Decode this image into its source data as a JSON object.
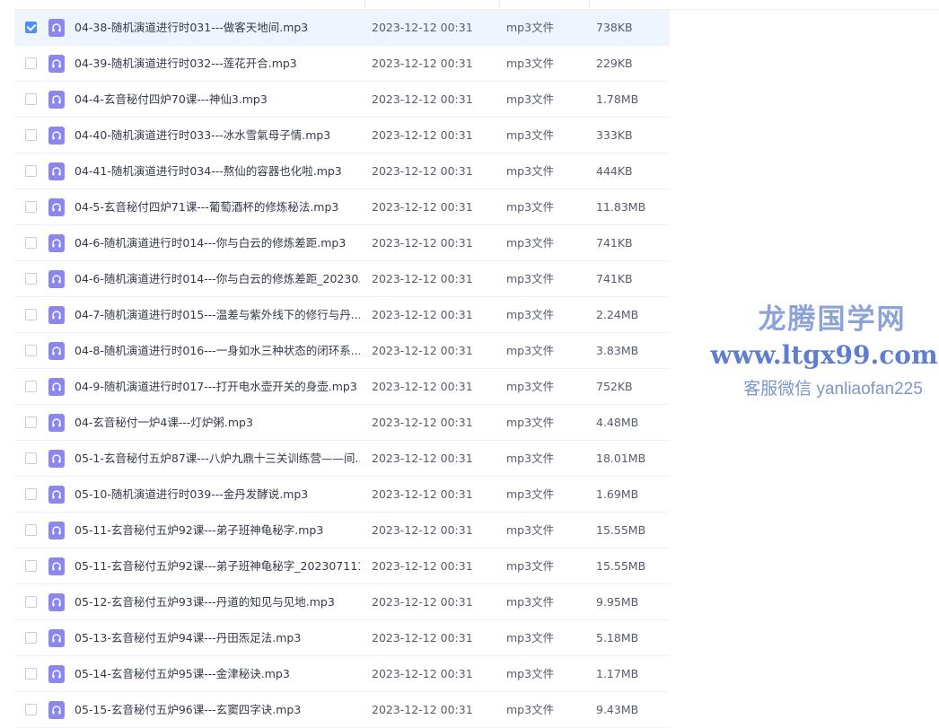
{
  "files": [
    {
      "name": "04-38-随机演道进行时031---做客天地间.mp3",
      "date": "2023-12-12 00:31",
      "type": "mp3文件",
      "size": "738KB",
      "checked": true
    },
    {
      "name": "04-39-随机演道进行时032---莲花开合.mp3",
      "date": "2023-12-12 00:31",
      "type": "mp3文件",
      "size": "229KB",
      "checked": false
    },
    {
      "name": "04-4-玄音秘付四炉70课---神仙3.mp3",
      "date": "2023-12-12 00:31",
      "type": "mp3文件",
      "size": "1.78MB",
      "checked": false
    },
    {
      "name": "04-40-随机演道进行时033---冰水雪氣母子情.mp3",
      "date": "2023-12-12 00:31",
      "type": "mp3文件",
      "size": "333KB",
      "checked": false
    },
    {
      "name": "04-41-随机演道进行时034---熬仙的容器也化啦.mp3",
      "date": "2023-12-12 00:31",
      "type": "mp3文件",
      "size": "444KB",
      "checked": false
    },
    {
      "name": "04-5-玄音秘付四炉71课---葡萄酒杯的修炼秘法.mp3",
      "date": "2023-12-12 00:31",
      "type": "mp3文件",
      "size": "11.83MB",
      "checked": false
    },
    {
      "name": "04-6-随机演道进行时014---你与白云的修炼差距.mp3",
      "date": "2023-12-12 00:31",
      "type": "mp3文件",
      "size": "741KB",
      "checked": false
    },
    {
      "name": "04-6-随机演道进行时014---你与白云的修炼差距_20230...",
      "date": "2023-12-12 00:31",
      "type": "mp3文件",
      "size": "741KB",
      "checked": false
    },
    {
      "name": "04-7-随机演道进行时015---温差与紫外线下的修行与丹...",
      "date": "2023-12-12 00:31",
      "type": "mp3文件",
      "size": "2.24MB",
      "checked": false
    },
    {
      "name": "04-8-随机演道进行时016---一身如水三种状态的闭环系...",
      "date": "2023-12-12 00:31",
      "type": "mp3文件",
      "size": "3.83MB",
      "checked": false
    },
    {
      "name": "04-9-随机演道进行时017---打开电水壶开关的身壶.mp3",
      "date": "2023-12-12 00:31",
      "type": "mp3文件",
      "size": "752KB",
      "checked": false
    },
    {
      "name": "04-玄音秘付一炉4课---灯炉粥.mp3",
      "date": "2023-12-12 00:31",
      "type": "mp3文件",
      "size": "4.48MB",
      "checked": false
    },
    {
      "name": "05-1-玄音秘付五炉87课---八炉九鼎十三关训练营——间...",
      "date": "2023-12-12 00:31",
      "type": "mp3文件",
      "size": "18.01MB",
      "checked": false
    },
    {
      "name": "05-10-随机演道进行时039---金丹发酵说.mp3",
      "date": "2023-12-12 00:31",
      "type": "mp3文件",
      "size": "1.69MB",
      "checked": false
    },
    {
      "name": "05-11-玄音秘付五炉92课---弟子班神龟秘字.mp3",
      "date": "2023-12-12 00:31",
      "type": "mp3文件",
      "size": "15.55MB",
      "checked": false
    },
    {
      "name": "05-11-玄音秘付五炉92课---弟子班神龟秘字_202307111...",
      "date": "2023-12-12 00:31",
      "type": "mp3文件",
      "size": "15.55MB",
      "checked": false
    },
    {
      "name": "05-12-玄音秘付五炉93课---丹道的知见与见地.mp3",
      "date": "2023-12-12 00:31",
      "type": "mp3文件",
      "size": "9.95MB",
      "checked": false
    },
    {
      "name": "05-13-玄音秘付五炉94课---丹田炁足法.mp3",
      "date": "2023-12-12 00:31",
      "type": "mp3文件",
      "size": "5.18MB",
      "checked": false
    },
    {
      "name": "05-14-玄音秘付五炉95课---金津秘诀.mp3",
      "date": "2023-12-12 00:31",
      "type": "mp3文件",
      "size": "1.17MB",
      "checked": false
    },
    {
      "name": "05-15-玄音秘付五炉96课---玄窦四字诀.mp3",
      "date": "2023-12-12 00:31",
      "type": "mp3文件",
      "size": "9.43MB",
      "checked": false
    }
  ],
  "watermark": {
    "line1": "龙腾国学网",
    "line2": "www.ltgx99.com",
    "line3": "客服微信 yanliaofan225"
  },
  "colors": {
    "accent": "#4d8ff7",
    "selected_row": "#eef5fe",
    "file_icon": "#8b86f0"
  },
  "icons": {
    "file_icon": "audio-file-icon",
    "checkbox": "checkbox-icon"
  }
}
